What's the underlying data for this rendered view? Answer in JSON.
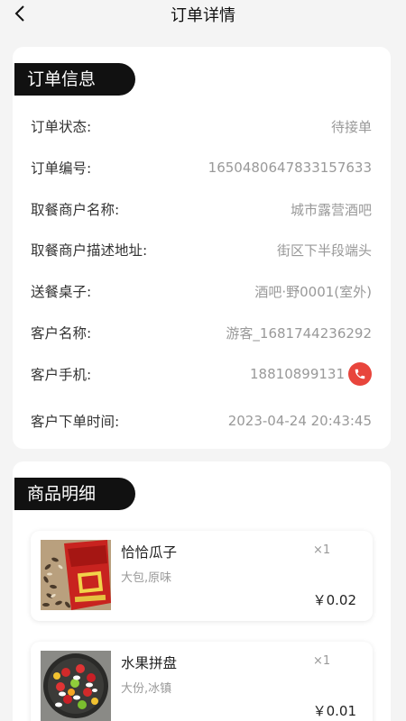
{
  "nav": {
    "title": "订单详情",
    "back_icon": "chevron-left-icon"
  },
  "order_info": {
    "section_title": "订单信息",
    "rows": [
      {
        "label": "订单状态:",
        "value": "待接单"
      },
      {
        "label": "订单编号:",
        "value": "1650480647833157633"
      },
      {
        "label": "取餐商户名称:",
        "value": "城市露营酒吧"
      },
      {
        "label": "取餐商户描述地址:",
        "value": "街区下半段端头"
      },
      {
        "label": "送餐桌子:",
        "value": "酒吧·野0001(室外)"
      },
      {
        "label": "客户名称:",
        "value": "游客_1681744236292"
      },
      {
        "label": "客户手机:",
        "value": "18810899131",
        "icon": "phone-icon"
      },
      {
        "label": "客户下单时间:",
        "value": "2023-04-24 20:43:45"
      }
    ]
  },
  "goods": {
    "section_title": "商品明细",
    "items": [
      {
        "name": "恰恰瓜子",
        "spec": "大包,原味",
        "qty": "×1",
        "price": "￥0.02",
        "image": "sunflower-seeds-package"
      },
      {
        "name": "水果拼盘",
        "spec": "大份,冰镇",
        "qty": "×1",
        "price": "￥0.01",
        "image": "fruit-platter"
      }
    ]
  },
  "colors": {
    "pill_bg": "#111111",
    "phone_button": "#e8453c",
    "page_bg": "#f4f4f4"
  }
}
